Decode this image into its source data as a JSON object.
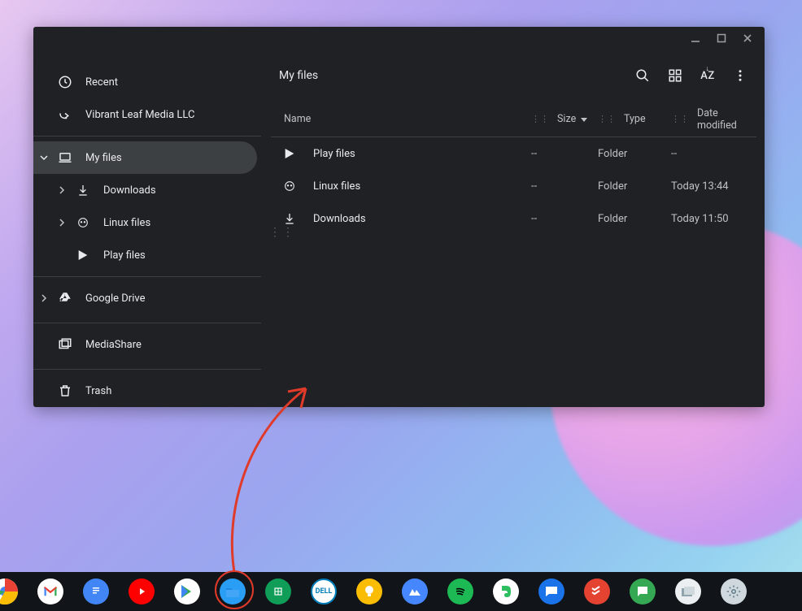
{
  "sidebar": {
    "recent": "Recent",
    "shortcut": "Vibrant Leaf Media LLC",
    "my_files": "My files",
    "downloads": "Downloads",
    "linux": "Linux files",
    "play": "Play files",
    "drive": "Google Drive",
    "mediashare": "MediaShare",
    "trash": "Trash"
  },
  "toolbar": {
    "title": "My files"
  },
  "columns": {
    "name": "Name",
    "size": "Size",
    "type": "Type",
    "date": "Date modified"
  },
  "rows": [
    {
      "name": "Play files",
      "size": "--",
      "type": "Folder",
      "date": "--"
    },
    {
      "name": "Linux files",
      "size": "--",
      "type": "Folder",
      "date": "Today 13:44"
    },
    {
      "name": "Downloads",
      "size": "--",
      "type": "Folder",
      "date": "Today 11:50"
    }
  ],
  "sort_az": "AZ",
  "taskbar": [
    "chrome",
    "gmail",
    "docs",
    "youtube",
    "play-store",
    "files",
    "sheets",
    "dell",
    "keep",
    "nordvpn",
    "spotify",
    "evernote",
    "messages",
    "todoist",
    "chat",
    "calc",
    "settings"
  ]
}
